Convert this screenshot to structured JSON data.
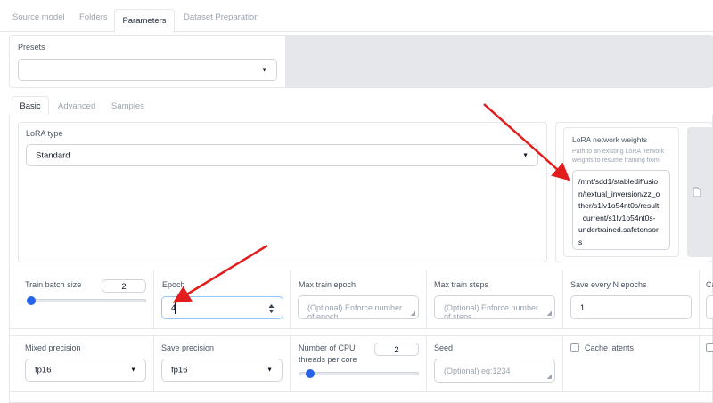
{
  "top_tabs": [
    "Source model",
    "Folders",
    "Parameters",
    "Dataset Preparation"
  ],
  "presets": {
    "label": "Presets",
    "value": ""
  },
  "sub_tabs": [
    "Basic",
    "Advanced",
    "Samples"
  ],
  "lora_type": {
    "label": "LoRA type",
    "value": "Standard"
  },
  "lora_weights": {
    "label": "LoRA network weights",
    "description": "Path to an existing LoRA network weights to resume training from",
    "value_lines": [
      "/mnt/sdd1/stablediffusio",
      "n/textual_inversion/zz_o",
      "ther/s1lv1o54nt0s/result",
      "_current/s1lv1o54nt0s-",
      "undertrained.safetensor",
      "s"
    ]
  },
  "row1": {
    "train_batch_size": {
      "label": "Train batch size",
      "value": "2",
      "slider_fraction": 0.0
    },
    "epoch": {
      "label": "Epoch",
      "value": "4"
    },
    "max_train_epoch": {
      "label": "Max train epoch",
      "placeholder": "(Optional) Enforce number of epoch"
    },
    "max_train_steps": {
      "label": "Max train steps",
      "placeholder": "(Optional) Enforce number of steps"
    },
    "save_every": {
      "label": "Save every N epochs",
      "value": "1"
    },
    "cut_label": "Ca"
  },
  "row2": {
    "mixed_precision": {
      "label": "Mixed precision",
      "value": "fp16"
    },
    "save_precision": {
      "label": "Save precision",
      "value": "fp16"
    },
    "cpu_threads": {
      "label_line1": "Number of CPU",
      "label_line2": "threads per core",
      "value": "2",
      "slider_fraction": 0.1
    },
    "seed": {
      "label": "Seed",
      "placeholder": "(Optional) eg:1234"
    },
    "cache_latents": {
      "label": "Cache latents",
      "checked": false
    }
  },
  "colors": {
    "accent": "#2563eb",
    "annotation_arrow": "#e11d1d"
  },
  "icons": {
    "caret": "▼",
    "file": "file-icon",
    "spinner": "stepper-icon"
  }
}
